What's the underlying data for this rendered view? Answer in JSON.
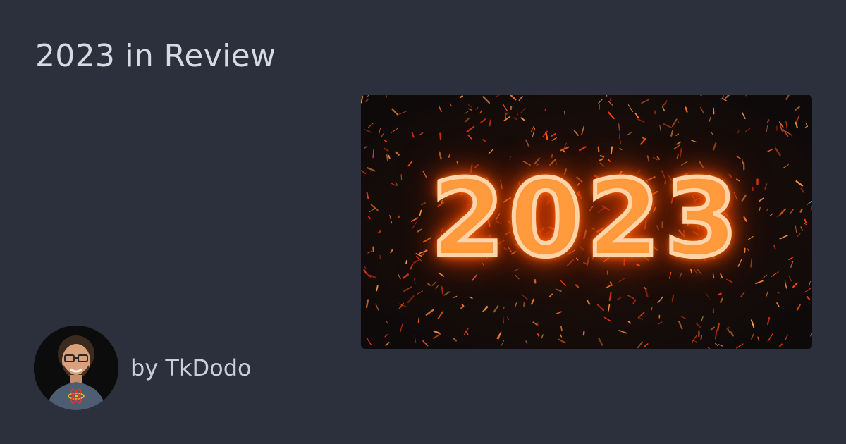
{
  "page": {
    "title": "2023 in Review",
    "byline": "by TkDodo",
    "background_color": "#2b303c"
  },
  "hero_image": {
    "text": "2023",
    "style": "fiery glowing outline digits over scattered ember sparks on dark background",
    "accent_color": "#ff6a1a"
  },
  "avatar": {
    "icon": "author-avatar-photo",
    "description_hint": "smiling person with glasses and beard wearing a dark tee with React logo"
  }
}
